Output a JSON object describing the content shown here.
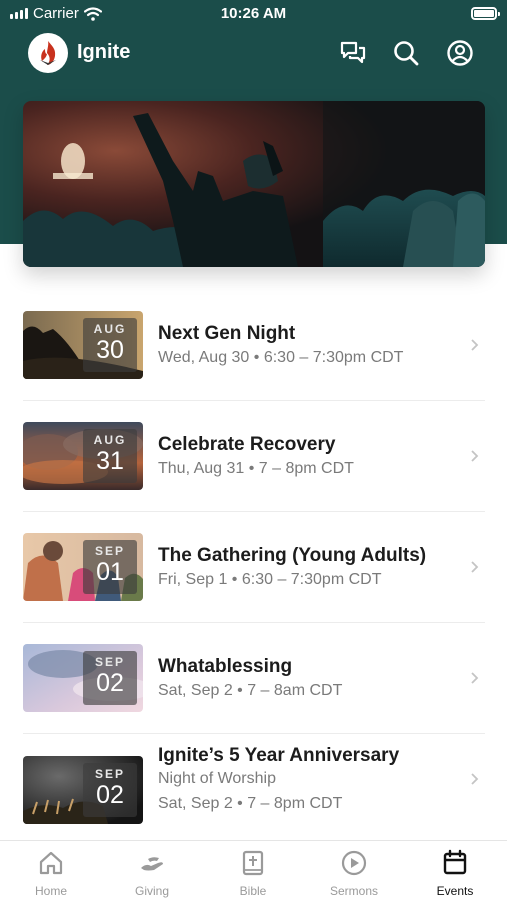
{
  "status_bar": {
    "carrier": "Carrier",
    "time": "10:26 AM"
  },
  "app": {
    "title": "Ignite"
  },
  "top_icons": [
    "chat-icon",
    "search-icon",
    "profile-icon"
  ],
  "events": [
    {
      "month": "AUG",
      "day": "30",
      "title": "Next Gen Night",
      "subtitle": "Wed, Aug 30 • 6:30 – 7:30pm CDT"
    },
    {
      "month": "AUG",
      "day": "31",
      "title": "Celebrate Recovery",
      "subtitle": "Thu, Aug 31 • 7 – 8pm CDT"
    },
    {
      "month": "SEP",
      "day": "01",
      "title": "The Gathering (Young Adults)",
      "subtitle": "Fri, Sep 1 • 6:30 – 7:30pm CDT"
    },
    {
      "month": "SEP",
      "day": "02",
      "title": "Whatablessing",
      "subtitle": "Sat, Sep 2 • 7 – 8am CDT"
    },
    {
      "month": "SEP",
      "day": "02",
      "title": "Ignite’s 5 Year Anniversary",
      "subtitle": "Night of Worship",
      "subtitle2": "Sat, Sep 2 • 7 – 8pm CDT"
    }
  ],
  "tabs": [
    {
      "label": "Home",
      "icon": "home-icon"
    },
    {
      "label": "Giving",
      "icon": "giving-icon"
    },
    {
      "label": "Bible",
      "icon": "bible-icon"
    },
    {
      "label": "Sermons",
      "icon": "play-icon"
    },
    {
      "label": "Events",
      "icon": "calendar-icon",
      "active": true
    }
  ],
  "colors": {
    "header": "#1b4d4a",
    "brand_red": "#c8321e",
    "inactive_tab": "#9a9a9a"
  }
}
